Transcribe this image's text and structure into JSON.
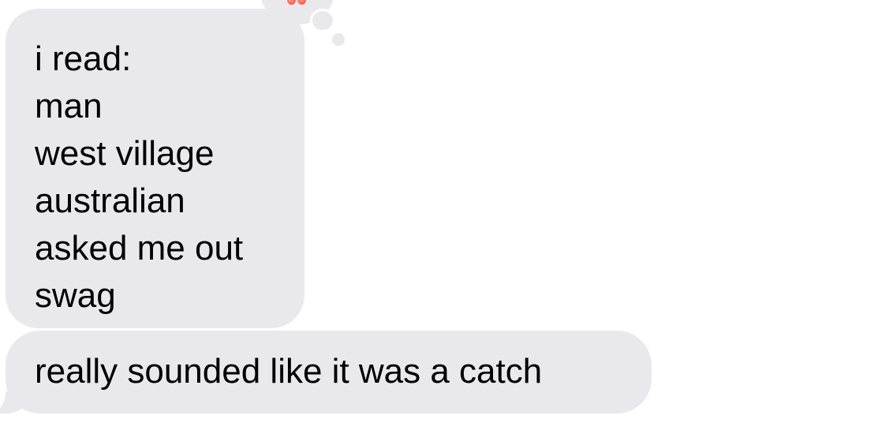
{
  "conversation": {
    "messages": [
      {
        "side": "incoming",
        "lines": [
          "i read:",
          "man",
          "west village",
          "australian",
          "asked me out",
          "swag"
        ],
        "reaction_icon": "laughing-emoji-icon"
      },
      {
        "side": "incoming",
        "text": "really sounded like it was a catch"
      }
    ]
  },
  "colors": {
    "incoming_bubble": "#e9e9eb",
    "text": "#000000",
    "background": "#ffffff"
  }
}
